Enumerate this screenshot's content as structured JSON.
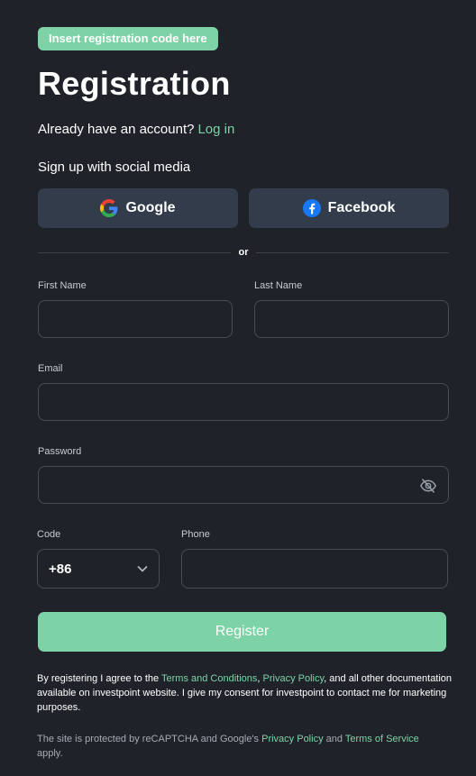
{
  "badge": {
    "label": "Insert registration code here"
  },
  "header": {
    "title": "Registration",
    "account_prompt": "Already have an account?",
    "login_link": "Log in"
  },
  "social": {
    "label": "Sign up with social media",
    "google_label": "Google",
    "facebook_label": "Facebook",
    "divider": "or"
  },
  "form": {
    "first_name": {
      "label": "First Name",
      "value": ""
    },
    "last_name": {
      "label": "Last Name",
      "value": ""
    },
    "email": {
      "label": "Email",
      "value": ""
    },
    "password": {
      "label": "Password",
      "value": ""
    },
    "code": {
      "label": "Code",
      "value": "+86"
    },
    "phone": {
      "label": "Phone",
      "value": ""
    },
    "register_label": "Register"
  },
  "consent": {
    "part1": "By registering I agree to the ",
    "terms_link": "Terms and Conditions",
    "sep": ", ",
    "privacy_link": "Privacy Policy",
    "part2": ", and all other documentation available on investpoint website. I give my consent for investpoint to contact me for marketing purposes."
  },
  "recaptcha": {
    "part1": "The site is protected by reCAPTCHA and Google's ",
    "privacy_link": "Privacy Policy",
    "and": " and ",
    "terms_link": "Terms of Service",
    "part2": " apply."
  },
  "colors": {
    "background": "#1f2229",
    "accent": "#7dd3a6",
    "social_button": "#333c4a",
    "field_border": "#474c56"
  }
}
